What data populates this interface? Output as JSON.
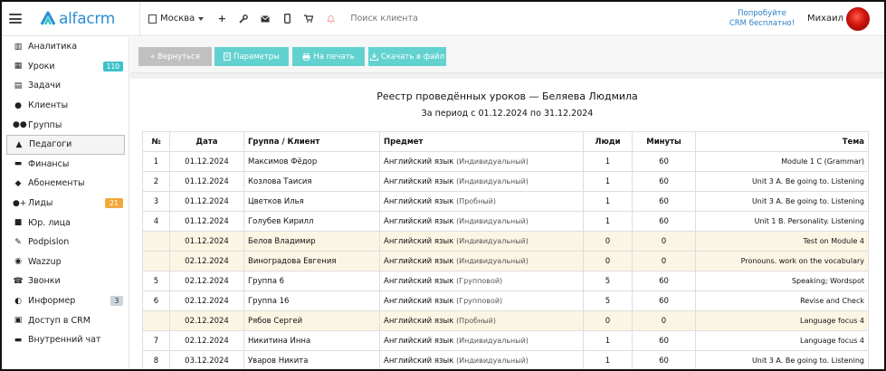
{
  "header": {
    "logo_text": "alfacrm",
    "city": "Москва",
    "search_placeholder": "Поиск клиента",
    "promo_line1": "Попробуйте",
    "promo_line2": "CRM бесплатно!",
    "user_name": "Михаил"
  },
  "colors": {
    "accent": "#2d8fd5",
    "button": "#62d2d0",
    "button_disabled": "#c0c0c0",
    "highlight_row": "#fbf6e4"
  },
  "sidebar": {
    "items": [
      {
        "label": "Аналитика",
        "icon": "chart-icon",
        "badge": ""
      },
      {
        "label": "Уроки",
        "icon": "calendar-icon",
        "badge": "110",
        "badge_color": "teal"
      },
      {
        "label": "Задачи",
        "icon": "tasks-icon",
        "badge": ""
      },
      {
        "label": "Клиенты",
        "icon": "user-icon",
        "badge": ""
      },
      {
        "label": "Группы",
        "icon": "users-icon",
        "badge": ""
      },
      {
        "label": "Педагоги",
        "icon": "graduation-cap-icon",
        "badge": "",
        "active": true
      },
      {
        "label": "Финансы",
        "icon": "money-icon",
        "badge": ""
      },
      {
        "label": "Абонементы",
        "icon": "tag-icon",
        "badge": ""
      },
      {
        "label": "Лиды",
        "icon": "user-plus-icon",
        "badge": "21",
        "badge_color": "orange"
      },
      {
        "label": "Юр. лица",
        "icon": "truck-icon",
        "badge": ""
      },
      {
        "label": "Podpislon",
        "icon": "pen-icon",
        "badge": ""
      },
      {
        "label": "Wazzup",
        "icon": "whatsapp-icon",
        "badge": ""
      },
      {
        "label": "Звонки",
        "icon": "phone-icon",
        "badge": ""
      },
      {
        "label": "Информер",
        "icon": "bell-icon",
        "badge": "3",
        "badge_color": "gray"
      },
      {
        "label": "Доступ в CRM",
        "icon": "lock-icon",
        "badge": ""
      },
      {
        "label": "Внутренний чат",
        "icon": "chat-icon",
        "badge": ""
      }
    ]
  },
  "toolbar": {
    "back_label": "« Вернуться",
    "params_label": "Параметры",
    "print_label": "На печать",
    "download_label": "Скачать в файл"
  },
  "report": {
    "title": "Реестр проведённых уроков",
    "title_sep": " — ",
    "teacher": "Беляева Людмила",
    "period": "За период с 01.12.2024 по 31.12.2024",
    "columns": [
      "№",
      "Дата",
      "Группа / Клиент",
      "Предмет",
      "Люди",
      "Минуты",
      "Тема"
    ],
    "rows": [
      {
        "no": "1",
        "date": "01.12.2024",
        "client": "Максимов Фёдор",
        "subject": "Английский язык",
        "type": "(Индивидуальный)",
        "people": "1",
        "minutes": "60",
        "topic": "Module 1 C (Grammar)",
        "hl": false
      },
      {
        "no": "2",
        "date": "01.12.2024",
        "client": "Козлова Таисия",
        "subject": "Английский язык",
        "type": "(Индивидуальный)",
        "people": "1",
        "minutes": "60",
        "topic": "Unit 3 A. Be going to. Listening",
        "hl": false
      },
      {
        "no": "3",
        "date": "01.12.2024",
        "client": "Цветков Илья",
        "subject": "Английский язык",
        "type": "(Пробный)",
        "people": "1",
        "minutes": "60",
        "topic": "Unit 3 A. Be going to. Listening",
        "hl": false
      },
      {
        "no": "4",
        "date": "01.12.2024",
        "client": "Голубев Кирилл",
        "subject": "Английский язык",
        "type": "(Индивидуальный)",
        "people": "1",
        "minutes": "60",
        "topic": "Unit 1 B. Personality. Listening",
        "hl": false
      },
      {
        "no": "",
        "date": "01.12.2024",
        "client": "Белов Владимир",
        "subject": "Английский язык",
        "type": "(Индивидуальный)",
        "people": "0",
        "minutes": "0",
        "topic": "Test on Module 4",
        "hl": true
      },
      {
        "no": "",
        "date": "02.12.2024",
        "client": "Виноградова Евгения",
        "subject": "Английский язык",
        "type": "(Индивидуальный)",
        "people": "0",
        "minutes": "0",
        "topic": "Pronouns. work on the vocabulary",
        "hl": true
      },
      {
        "no": "5",
        "date": "02.12.2024",
        "client": "Группа 6",
        "subject": "Английский язык",
        "type": "(Групповой)",
        "people": "5",
        "minutes": "60",
        "topic": "Speaking; Wordspot",
        "hl": false
      },
      {
        "no": "6",
        "date": "02.12.2024",
        "client": "Группа 16",
        "subject": "Английский язык",
        "type": "(Групповой)",
        "people": "5",
        "minutes": "60",
        "topic": "Revise and Check",
        "hl": false
      },
      {
        "no": "",
        "date": "02.12.2024",
        "client": "Рябов Сергей",
        "subject": "Английский язык",
        "type": "(Пробный)",
        "people": "0",
        "minutes": "0",
        "topic": "Language focus 4",
        "hl": true
      },
      {
        "no": "7",
        "date": "02.12.2024",
        "client": "Никитина Инна",
        "subject": "Английский язык",
        "type": "(Индивидуальный)",
        "people": "1",
        "minutes": "60",
        "topic": "Language focus 4",
        "hl": false
      },
      {
        "no": "8",
        "date": "03.12.2024",
        "client": "Уваров Никита",
        "subject": "Английский язык",
        "type": "(Индивидуальный)",
        "people": "1",
        "minutes": "60",
        "topic": "Unit 3 A. Be going to. Listening",
        "hl": false
      }
    ]
  }
}
